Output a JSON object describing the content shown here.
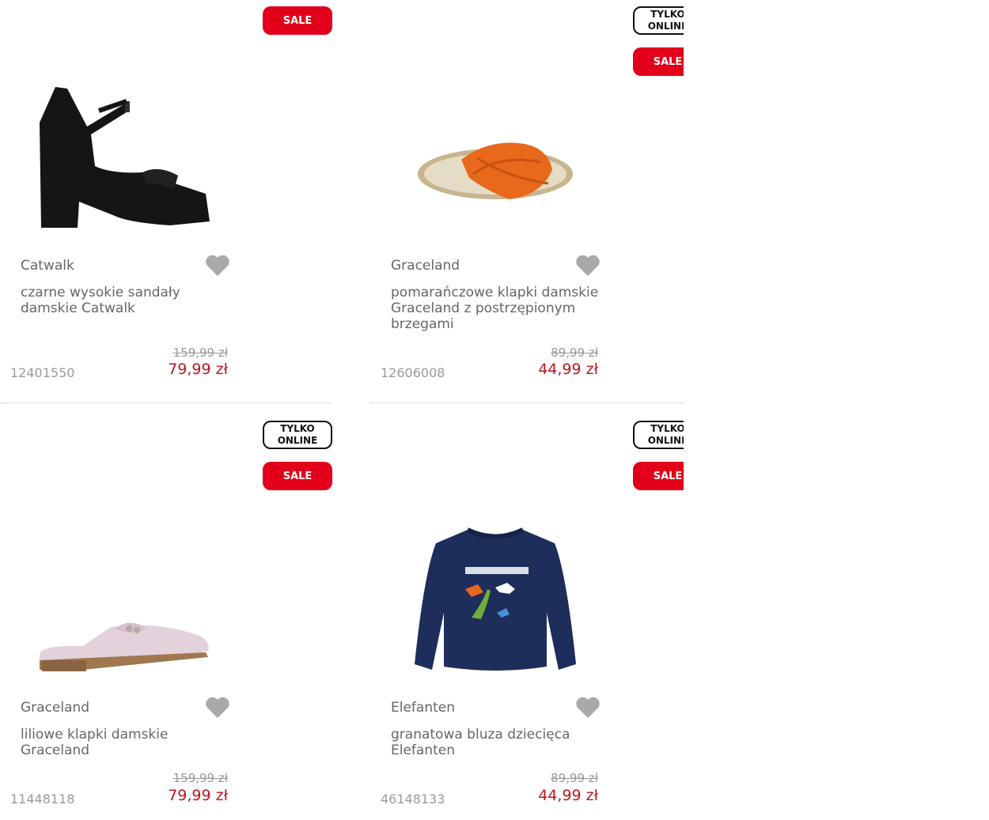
{
  "badges": {
    "sale": "SALE",
    "online": "TYLKO\nONLINE"
  },
  "products": [
    {
      "brand": "Catwalk",
      "name": "czarne wysokie sandały damskie Catwalk",
      "old_price": "159,99 zł",
      "price": "79,99 zł",
      "sku": "12401550",
      "image": "black-platform-sandal"
    },
    {
      "brand": "Graceland",
      "name": "pomarańczowe klapki damskie Graceland z postrzępionym brzegami",
      "old_price": "89,99 zł",
      "price": "44,99 zł",
      "sku": "12606008",
      "image": "orange-slipper"
    },
    {
      "brand": "Graceland",
      "name": "liliowe klapki damskie Graceland",
      "old_price": "159,99 zł",
      "price": "79,99 zł",
      "sku": "11448118",
      "image": "lilac-mule"
    },
    {
      "brand": "Elefanten",
      "name": "granatowa bluza dziecięca Elefanten",
      "old_price": "89,99 zł",
      "price": "44,99 zł",
      "sku": "46148133",
      "image": "navy-kids-sweatshirt"
    }
  ],
  "colors": {
    "sale": "#e2001a",
    "price": "#c0151f",
    "navy": "#1d2d5c"
  }
}
